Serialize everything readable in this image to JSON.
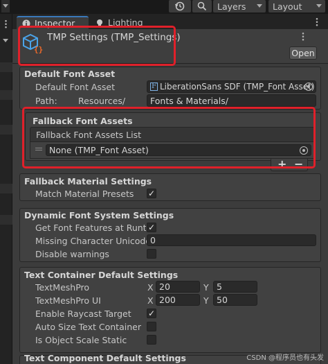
{
  "toolbar": {
    "layers_label": "Layers",
    "layout_label": "Layout",
    "history_icon": "history-icon",
    "search_icon": "search-icon"
  },
  "tabs": [
    {
      "label": "Inspector",
      "icon": "info-icon",
      "active": true
    },
    {
      "label": "Lighting",
      "icon": "lightbulb-icon",
      "active": false
    }
  ],
  "header": {
    "title": "TMP Settings (TMP_Settings)",
    "open_label": "Open",
    "asset_icon": "tmp-settings-asset-icon"
  },
  "default_font": {
    "title": "Default Font Asset",
    "font_label": "Default Font Asset",
    "font_value": "LiberationSans SDF (TMP_Font Asset)",
    "path_label": "Path:",
    "path_prefix": "Resources/",
    "path_value": "Fonts & Materials/"
  },
  "fallback": {
    "title": "Fallback Font Assets",
    "list_label": "Fallback Font Assets List",
    "items": [
      {
        "value": "None (TMP_Font Asset)"
      }
    ],
    "add_label": "+",
    "remove_label": "−"
  },
  "fallback_material": {
    "title": "Fallback Material Settings",
    "match_label": "Match Material Presets",
    "match_checked": "✓"
  },
  "dynamic_font": {
    "title": "Dynamic Font System Settings",
    "features_label": "Get Font Features at Runtim",
    "features_checked": "✓",
    "missing_label": "Missing Character Unicode",
    "missing_value": "0",
    "warnings_label": "Disable warnings"
  },
  "text_container": {
    "title": "Text Container Default Settings",
    "tmp_label": "TextMeshPro",
    "tmp_x": "20",
    "tmp_y": "5",
    "tmpui_label": "TextMeshPro UI",
    "tmpui_x": "200",
    "tmpui_y": "50",
    "x_label": "X",
    "y_label": "Y",
    "raycast_label": "Enable Raycast Target",
    "raycast_checked": "✓",
    "autosize_label": "Auto Size Text Container",
    "scale_label": "Is Object Scale Static"
  },
  "text_component": {
    "title": "Text Component Default Settings"
  },
  "watermark": "CSDN @程序员也有头发",
  "colors": {
    "highlight_red": "#e0202a",
    "accent_blue": "#3a79bb",
    "panel_bg": "#3c3c3c"
  }
}
